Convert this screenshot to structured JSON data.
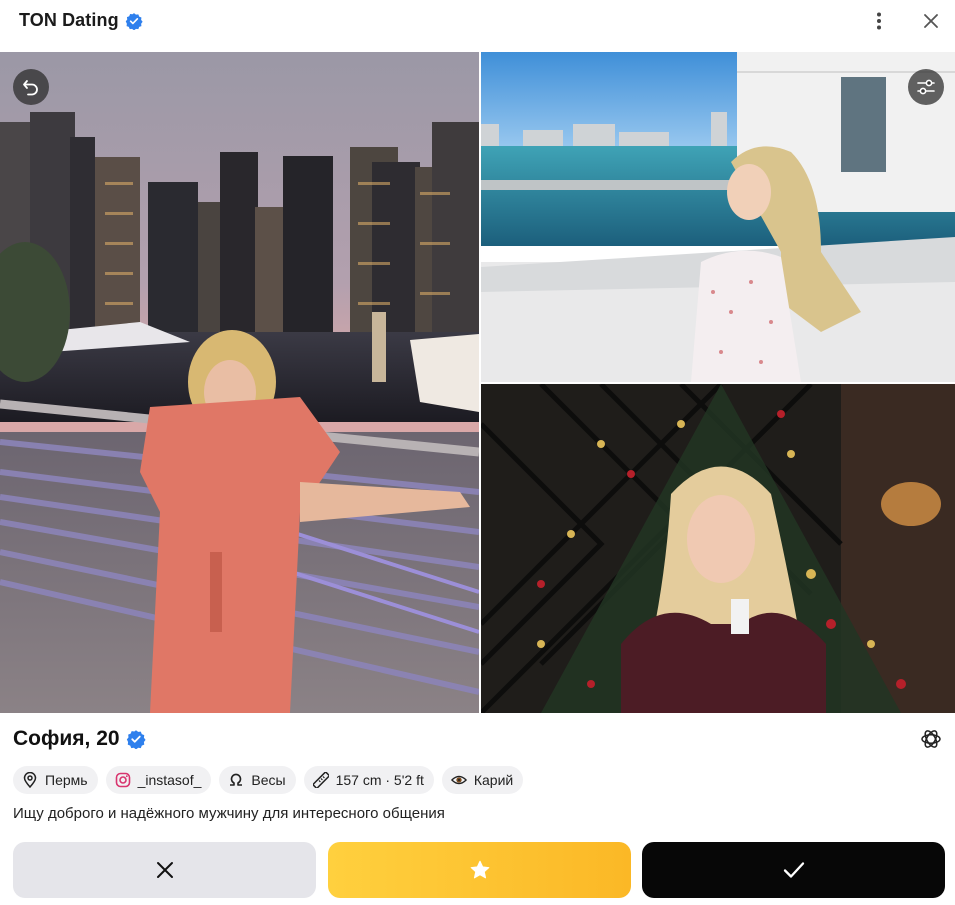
{
  "app": {
    "title": "TON Dating"
  },
  "profile": {
    "name_age": "София, 20",
    "chips": [
      {
        "icon": "location-pin-icon",
        "label": "Пермь"
      },
      {
        "icon": "instagram-icon",
        "label": "_instasof_"
      },
      {
        "icon": "zodiac-libra-icon",
        "label": "Весы"
      },
      {
        "icon": "ruler-icon",
        "label": "157 cm · 5'2 ft"
      },
      {
        "icon": "eye-icon",
        "label": "Карий"
      }
    ],
    "bio": "Ищу доброго и надёжного мужчину для интересного общения"
  },
  "colors": {
    "verified": "#2f80ed",
    "star_button": "#fcc12f",
    "like_button": "#070707",
    "dislike_button": "#e5e5ea"
  },
  "icons": {
    "menu": "more-vertical-icon",
    "close": "close-icon",
    "undo": "undo-icon",
    "filter": "filter-icon",
    "ai": "openai-icon",
    "dislike": "close-icon",
    "superlike": "star-icon",
    "like": "check-icon"
  }
}
